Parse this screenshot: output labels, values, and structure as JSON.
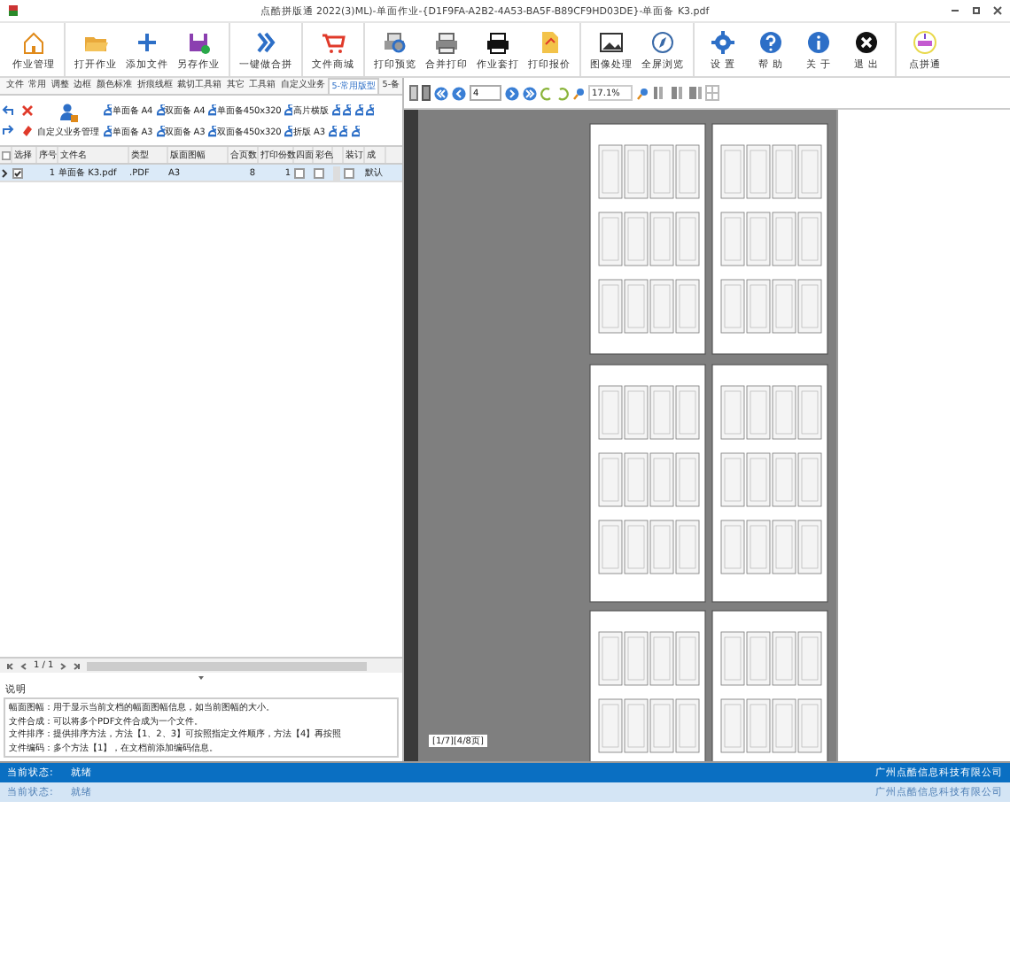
{
  "window": {
    "title": "点酷拼版通 2022(3)ML)-单面作业-{D1F9FA-A2B2-4A53-BA5F-B89CF9HD03DE}-单面备 K3.pdf"
  },
  "toolbar": [
    [
      {
        "label": "作业管理"
      }
    ],
    [
      {
        "label": "打开作业"
      },
      {
        "label": "添加文件"
      },
      {
        "label": "另存作业"
      }
    ],
    [
      {
        "label": "一键做合拼"
      }
    ],
    [
      {
        "label": "文件商城"
      }
    ],
    [
      {
        "label": "打印预览"
      },
      {
        "label": "合并打印"
      },
      {
        "label": "作业套打"
      },
      {
        "label": "打印报价"
      }
    ],
    [
      {
        "label": "图像处理"
      },
      {
        "label": "全屏浏览"
      }
    ],
    [
      {
        "label": "设 置"
      },
      {
        "label": "帮 助"
      },
      {
        "label": "关 于"
      },
      {
        "label": "退 出"
      }
    ],
    [
      {
        "label": "点拼通"
      }
    ]
  ],
  "ribbon_tabs": [
    {
      "label": "文件",
      "selected": false
    },
    {
      "label": "常用",
      "selected": false
    },
    {
      "label": "调整",
      "selected": false
    },
    {
      "label": "边框",
      "selected": false
    },
    {
      "label": "颜色标准",
      "selected": false
    },
    {
      "label": "折痕线框",
      "selected": false
    },
    {
      "label": "裁切工具箱",
      "selected": false
    },
    {
      "label": "其它",
      "selected": false
    },
    {
      "label": "工具箱",
      "selected": false
    },
    {
      "label": "自定义业务",
      "selected": false
    },
    {
      "label": "5-常用版型",
      "selected": true
    },
    {
      "label": "5-备",
      "selected": false
    }
  ],
  "ribbon": {
    "manage_button": "自定义业务管理",
    "presets": [
      [
        {
          "kind": "labeled",
          "label": "单面备 A4"
        },
        {
          "kind": "labeled",
          "label": "双面备 A4"
        },
        {
          "kind": "labeled",
          "label": "单面备450x320"
        },
        {
          "kind": "labeled",
          "label": "高片横版"
        },
        {
          "kind": "icon"
        },
        {
          "kind": "icon"
        },
        {
          "kind": "icon"
        },
        {
          "kind": "icon"
        }
      ],
      [
        {
          "kind": "labeled",
          "label": "单面备 A3"
        },
        {
          "kind": "labeled",
          "label": "双面备 A3"
        },
        {
          "kind": "labeled",
          "label": "双面备450x320"
        },
        {
          "kind": "labeled",
          "label": "折版 A3"
        },
        {
          "kind": "icon"
        },
        {
          "kind": "icon"
        },
        {
          "kind": "icon"
        }
      ]
    ]
  },
  "table": {
    "select_all": false,
    "columns": [
      "选择",
      "序号",
      "文件名",
      "类型",
      "版面图幅",
      "合页数",
      "打印份数",
      "四面",
      "彩色",
      "装订",
      "成"
    ],
    "rows": [
      {
        "selected": true,
        "checked": true,
        "index": "1",
        "file": "单面备 K3.pdf",
        "type": ".PDF",
        "size": "A3",
        "pages": "8",
        "copies": "1",
        "four_sided": false,
        "in_color": false,
        "bound": false,
        "cost": "默认"
      }
    ]
  },
  "pager": "1 / 1",
  "notes": {
    "title": "说明",
    "lines": [
      "幅面图幅：用于显示当前文档的幅面图幅信息，如当前图幅的大小。",
      "文件合成：可以将多个PDF文件合成为一个文件。",
      "文件排序：提供排序方法，方法【1、2、3】可按照指定文件顺序，方法【4】再按照",
      "文件编码：多个方法【1】，在文档前添加编码信息。"
    ]
  },
  "preview": {
    "page_input": "4",
    "zoom": "17.1%",
    "page_label": "[1/7][4/8页]"
  },
  "status_bar": {
    "label": "当前状态:",
    "value": "就绪",
    "company": "广州点酷信息科技有限公司"
  },
  "ghost_status": {
    "label": "当前状态:",
    "value": "就绪",
    "company": "广州点酷信息科技有限公司"
  }
}
